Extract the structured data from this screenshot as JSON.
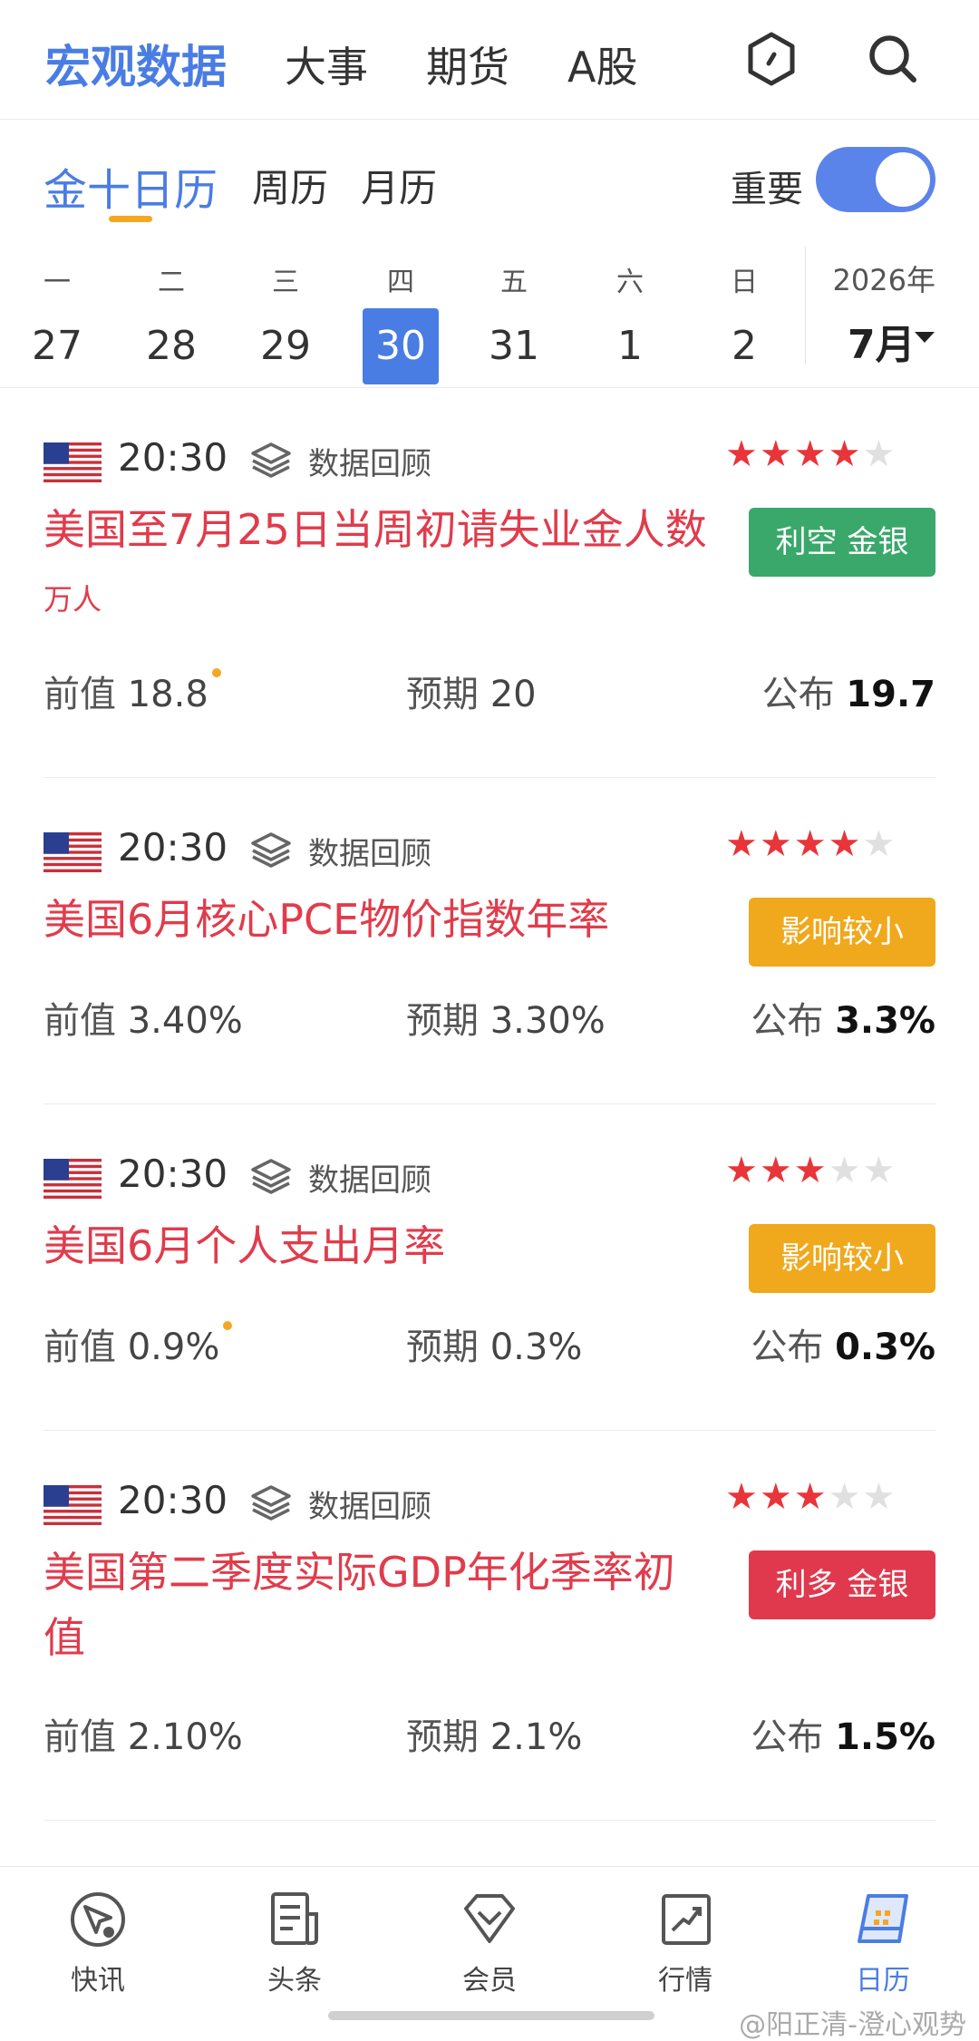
{
  "topnav": {
    "tabs": [
      "宏观数据",
      "大事",
      "期货",
      "A股"
    ],
    "active_color": "#4a7de3"
  },
  "subtabs": {
    "tabs": [
      "金十日历",
      "周历",
      "月历"
    ],
    "important_label": "重要",
    "important_on": true
  },
  "calendar": {
    "weekdays": [
      "一",
      "二",
      "三",
      "四",
      "五",
      "六",
      "日"
    ],
    "dates": [
      "27",
      "28",
      "29",
      "30",
      "31",
      "1",
      "2"
    ],
    "selected_index": 3,
    "year": "2026年",
    "month": "7月"
  },
  "events": [
    {
      "time": "20:30",
      "review": "数据回顾",
      "stars": 4,
      "max_stars": 5,
      "title": "美国至7月25日当周初请失业金人数",
      "unit": "万人",
      "badge": "利空 金银",
      "badge_color": "#3aa86b",
      "prev_label": "前值",
      "prev": "18.8",
      "prev_dot": true,
      "exp_label": "预期",
      "exp": "20",
      "pub_label": "公布",
      "pub": "19.7"
    },
    {
      "time": "20:30",
      "review": "数据回顾",
      "stars": 4,
      "max_stars": 5,
      "title": "美国6月核心PCE物价指数年率",
      "unit": "",
      "badge": "影响较小",
      "badge_color": "#f0a81c",
      "prev_label": "前值",
      "prev": "3.40%",
      "prev_dot": false,
      "exp_label": "预期",
      "exp": "3.30%",
      "pub_label": "公布",
      "pub": "3.3%"
    },
    {
      "time": "20:30",
      "review": "数据回顾",
      "stars": 3,
      "max_stars": 5,
      "title": "美国6月个人支出月率",
      "unit": "",
      "badge": "影响较小",
      "badge_color": "#f0a81c",
      "prev_label": "前值",
      "prev": "0.9%",
      "prev_dot": true,
      "exp_label": "预期",
      "exp": "0.3%",
      "pub_label": "公布",
      "pub": "0.3%"
    },
    {
      "time": "20:30",
      "review": "数据回顾",
      "stars": 3,
      "max_stars": 5,
      "title": "美国第二季度实际GDP年化季率初值",
      "unit": "",
      "badge": "利多 金银",
      "badge_color": "#e0394e",
      "prev_label": "前值",
      "prev": "2.10%",
      "prev_dot": false,
      "exp_label": "预期",
      "exp": "2.1%",
      "pub_label": "公布",
      "pub": "1.5%"
    }
  ],
  "bottomnav": {
    "items": [
      "快讯",
      "头条",
      "会员",
      "行情",
      "日历"
    ],
    "icons": [
      "flash-icon",
      "news-icon",
      "vip-diamond-icon",
      "market-chart-icon",
      "calendar-icon"
    ],
    "active_index": 4
  },
  "watermark": "@阳正清-澄心观势"
}
